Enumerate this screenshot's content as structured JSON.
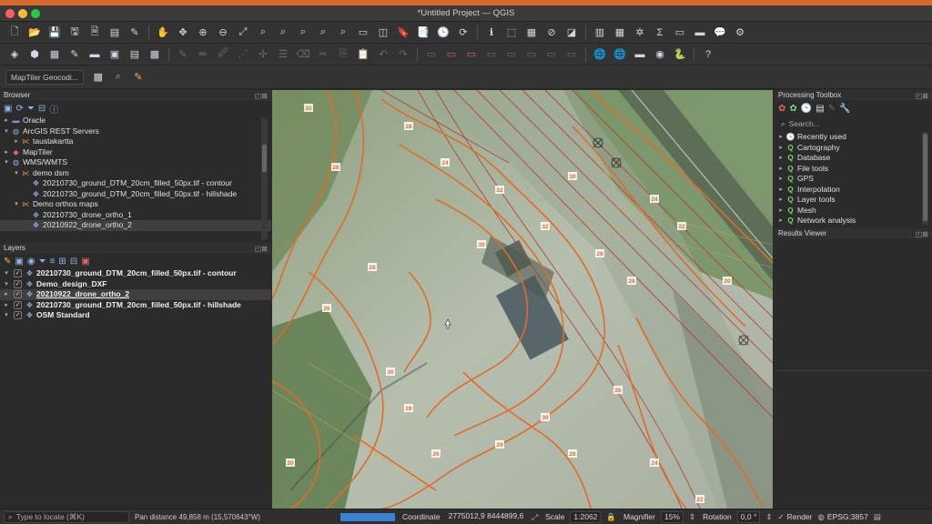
{
  "window": {
    "title": "*Untitled Project — QGIS"
  },
  "toolbar3": {
    "geocoder": "MapTiler Geocodi..."
  },
  "browser": {
    "title": "Browser",
    "items": [
      {
        "label": "Oracle",
        "level": 0,
        "caret": "▸",
        "icon": "database-icon"
      },
      {
        "label": "ArcGIS REST Servers",
        "level": 0,
        "caret": "▾",
        "icon": "globe-icon"
      },
      {
        "label": "taustakartta",
        "level": 1,
        "caret": "▸",
        "icon": "service-icon"
      },
      {
        "label": "MapTiler",
        "level": 0,
        "caret": "▸",
        "icon": "maptiler-icon"
      },
      {
        "label": "WMS/WMTS",
        "level": 0,
        "caret": "▾",
        "icon": "globe-icon"
      },
      {
        "label": "demo dsm",
        "level": 1,
        "caret": "▾",
        "icon": "service-icon"
      },
      {
        "label": "20210730_ground_DTM_20cm_filled_50px.tif - contour",
        "level": 2,
        "caret": "",
        "icon": "layer-icon"
      },
      {
        "label": "20210730_ground_DTM_20cm_filled_50px.tif - hillshade",
        "level": 2,
        "caret": "",
        "icon": "layer-icon"
      },
      {
        "label": "Demo orthos maps",
        "level": 1,
        "caret": "▾",
        "icon": "service-icon"
      },
      {
        "label": "20210730_drone_ortho_1",
        "level": 2,
        "caret": "",
        "icon": "layer-icon"
      },
      {
        "label": "20210922_drone_ortho_2",
        "level": 2,
        "caret": "",
        "icon": "layer-icon",
        "selected": true
      }
    ]
  },
  "layers": {
    "title": "Layers",
    "items": [
      {
        "label": "20210730_ground_DTM_20cm_filled_50px.tif - contour",
        "caret": "▾",
        "underline": false
      },
      {
        "label": "Demo_design_DXF",
        "caret": "▾",
        "underline": false
      },
      {
        "label": "20210922_drone_ortho_2",
        "caret": "▸",
        "underline": true,
        "selected": true
      },
      {
        "label": "20210730_ground_DTM_20cm_filled_50px.tif - hillshade",
        "caret": "▸",
        "underline": false
      },
      {
        "label": "OSM Standard",
        "caret": "▾",
        "underline": false
      }
    ]
  },
  "processing": {
    "title": "Processing Toolbox",
    "search_placeholder": "Search...",
    "items": [
      {
        "label": "Recently used",
        "icon": "clock-icon"
      },
      {
        "label": "Cartography",
        "icon": "q-icon"
      },
      {
        "label": "Database",
        "icon": "q-icon"
      },
      {
        "label": "File tools",
        "icon": "q-icon"
      },
      {
        "label": "GPS",
        "icon": "q-icon"
      },
      {
        "label": "Interpolation",
        "icon": "q-icon"
      },
      {
        "label": "Layer tools",
        "icon": "q-icon"
      },
      {
        "label": "Mesh",
        "icon": "q-icon"
      },
      {
        "label": "Network analysis",
        "icon": "q-icon"
      }
    ]
  },
  "results": {
    "title": "Results Viewer"
  },
  "status": {
    "locate_placeholder": "Type to locate (⌘K)",
    "message": "Pan distance 49,858 m (15,570643°W)",
    "progress": 1.0,
    "coordinate_label": "Coordinate",
    "coordinate_value": "2775012,9  8444899,6",
    "scale_label": "Scale",
    "scale_value": "1:2062",
    "magnifier_label": "Magnifier",
    "magnifier_value": "15%",
    "rotation_label": "Rotation",
    "rotation_value": "0,0 °",
    "render_label": "Render",
    "render_checked": true,
    "crs": "EPSG:3857"
  },
  "map": {
    "contour_labels": [
      "20",
      "26",
      "28",
      "24",
      "22",
      "30",
      "32",
      "30",
      "28",
      "26",
      "24",
      "22",
      "20",
      "30",
      "28",
      "26",
      "29",
      "30",
      "28",
      "26",
      "24",
      "22",
      "20",
      "26",
      "28"
    ]
  },
  "colors": {
    "contour": "#e36a2b",
    "design": "#b33a2c",
    "accent_progress": "#3b82d6"
  }
}
